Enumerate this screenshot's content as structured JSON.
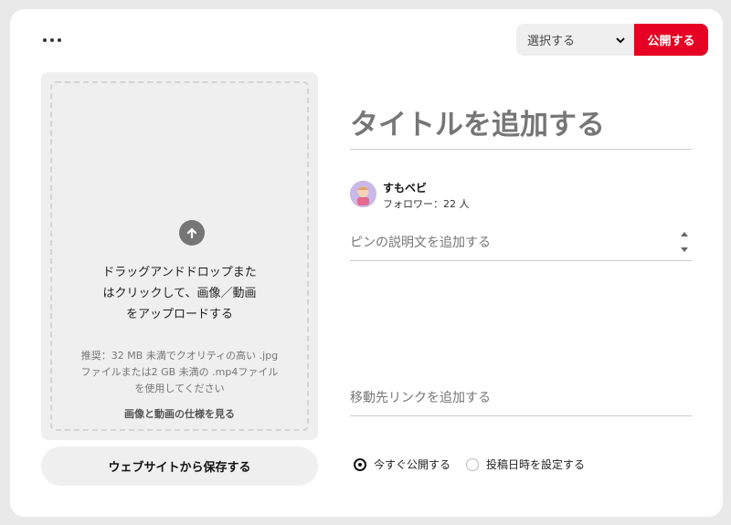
{
  "toolbar": {
    "board_select_label": "選択する",
    "publish_label": "公開する",
    "accent_color": "#e60023"
  },
  "upload": {
    "icon": "arrow-up-icon",
    "line1": "ドラッグアンドドロップまた",
    "line2": "はクリックして、画像／動画",
    "line3": "をアップロードする",
    "rec_line1": "推奨：32 MB 未満でクオリティの高い .jpg",
    "rec_line2": "ファイルまたは2 GB 未満の .mp4ファイル",
    "rec_line3": "を使用してください",
    "spec_link": "画像と動画の仕様を見る"
  },
  "save_from_site_label": "ウェブサイトから保存する",
  "form": {
    "title_placeholder": "タイトルを追加する",
    "user_name": "すもベビ",
    "followers": "フォロワー：22 人",
    "description_placeholder": "ピンの説明文を追加する",
    "link_placeholder": "移動先リンクを追加する"
  },
  "publish_options": {
    "now_label": "今すぐ公開する",
    "schedule_label": "投稿日時を設定する",
    "selected": "now"
  }
}
